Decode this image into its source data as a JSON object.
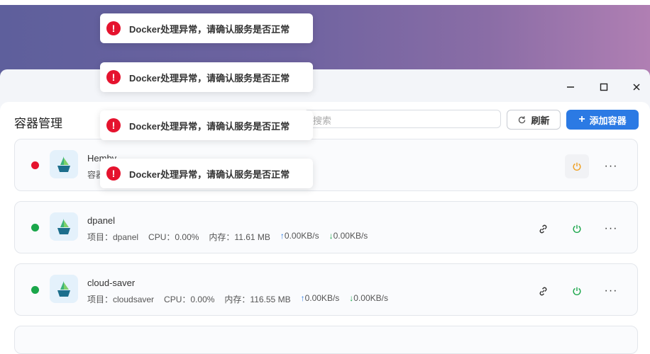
{
  "window": {
    "minimize_icon": "minimize-icon",
    "maximize_icon": "maximize-icon",
    "close_icon": "close-icon"
  },
  "header": {
    "title": "容器管理",
    "search_placeholder": "搜索",
    "refresh_label": "刷新",
    "add_label": "添加容器"
  },
  "colors": {
    "accent": "#2b7ae4",
    "status_running": "#1aa64a",
    "status_stopped": "#e5132e",
    "power_stopped": "#f0a020",
    "power_running": "#1aa64a"
  },
  "containers": [
    {
      "name": "Hemby",
      "project_label": "容器",
      "status": "stopped"
    },
    {
      "name": "dpanel",
      "project": "项目：dpanel",
      "cpu": "CPU：0.00%",
      "memory": "内存：11.61 MB",
      "upload": "0.00KB/s",
      "download": "0.00KB/s",
      "status": "running"
    },
    {
      "name": "cloud-saver",
      "project": "项目：cloudsaver",
      "cpu": "CPU：0.00%",
      "memory": "内存：116.55 MB",
      "upload": "0.00KB/s",
      "download": "0.00KB/s",
      "status": "running"
    }
  ],
  "toasts": [
    {
      "message": "Docker处理异常，请确认服务是否正常"
    },
    {
      "message": "Docker处理异常，请确认服务是否正常"
    },
    {
      "message": "Docker处理异常，请确认服务是否正常"
    },
    {
      "message": "Docker处理异常，请确认服务是否正常"
    }
  ]
}
